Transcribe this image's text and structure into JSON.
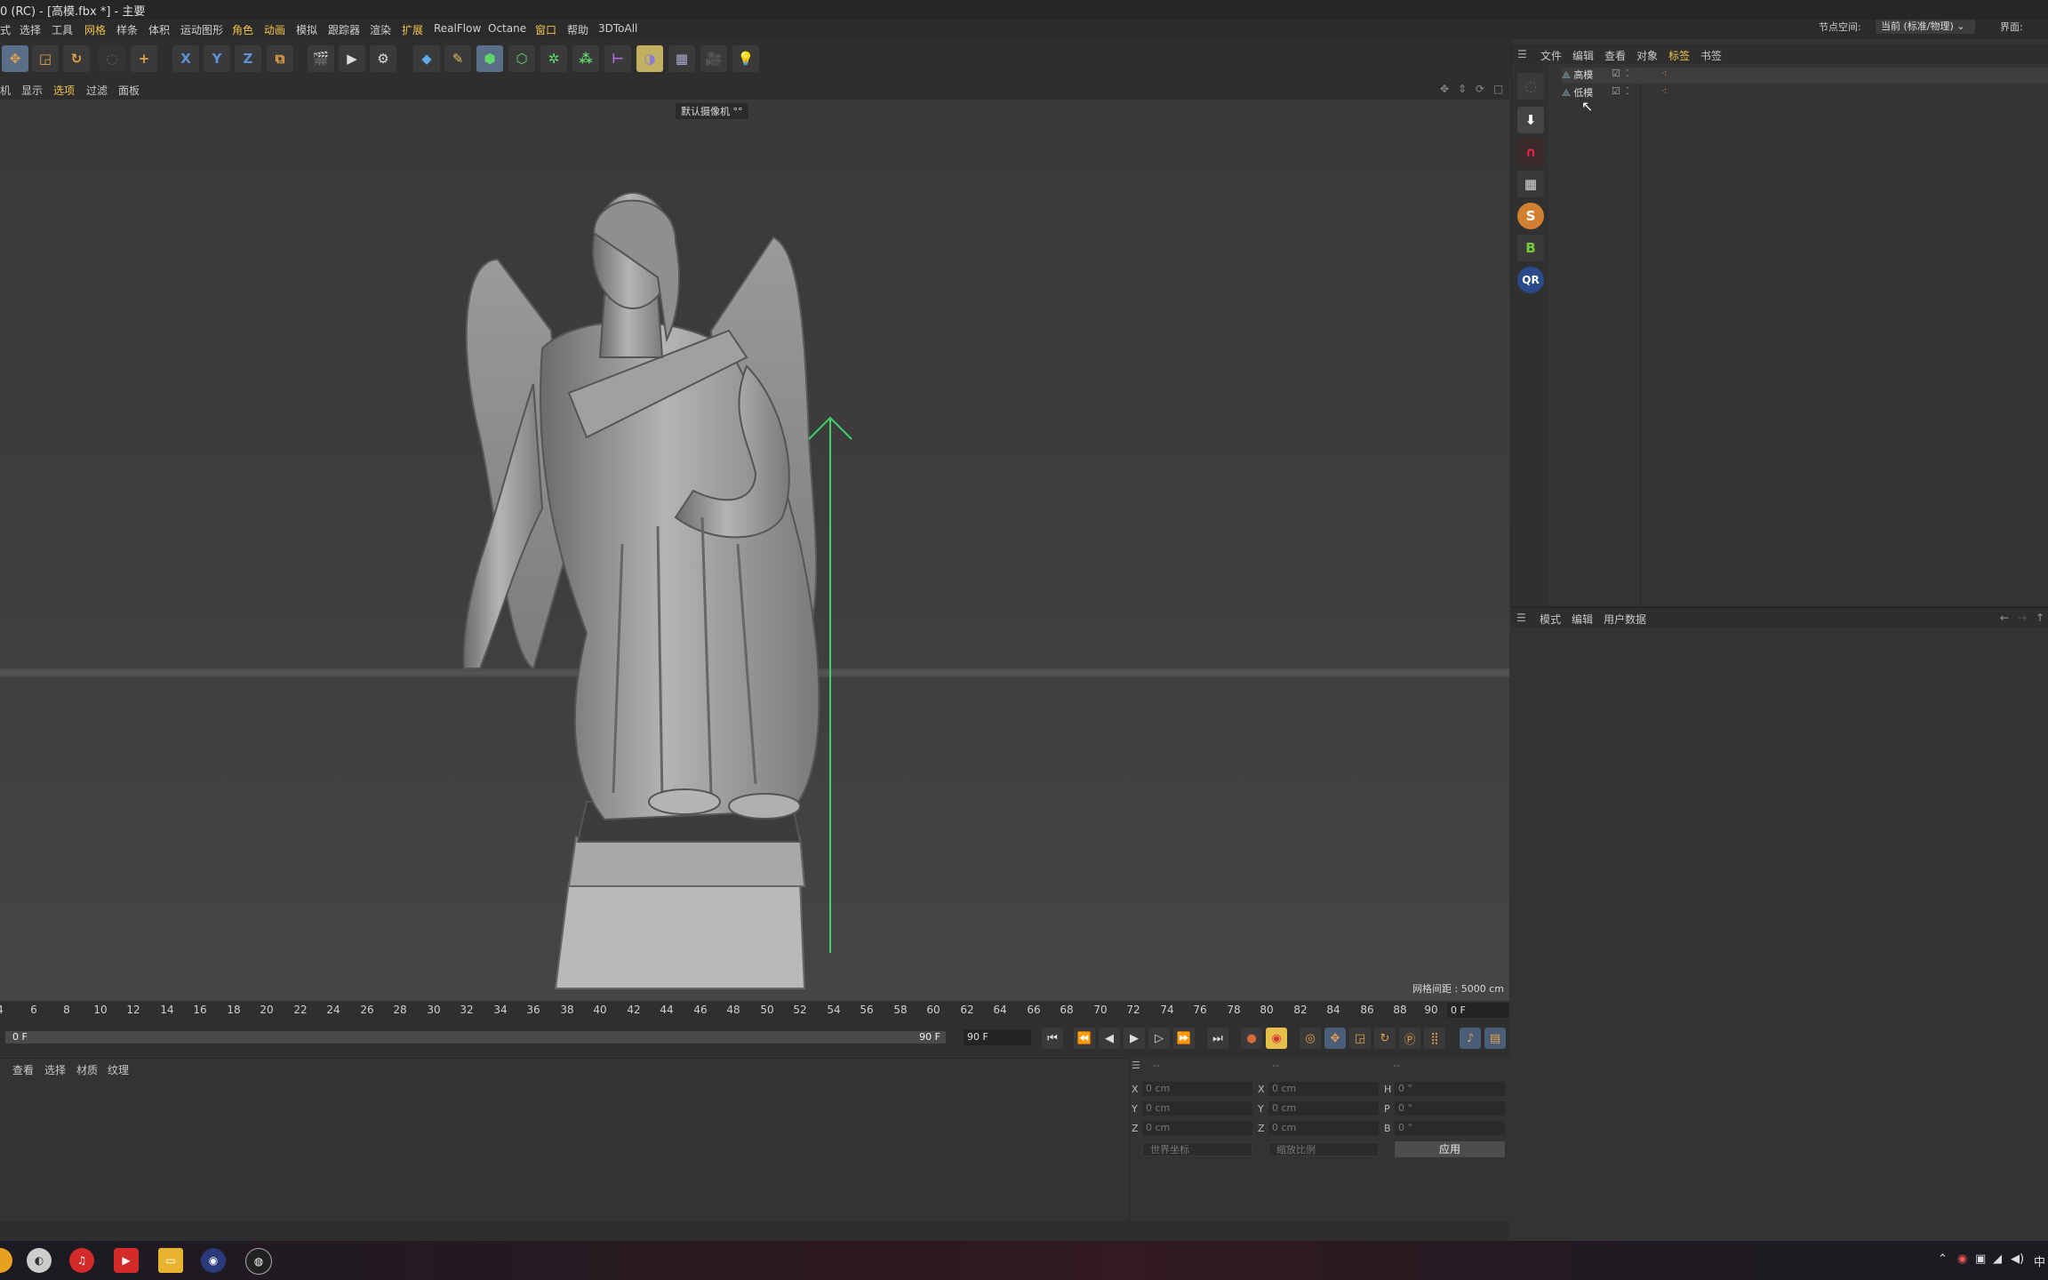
{
  "window": {
    "title": "0 (RC) - [高模.fbx *] - 主要"
  },
  "menubar": {
    "items": [
      "式",
      "选择",
      "工具",
      "网格",
      "样条",
      "体积",
      "运动图形",
      "角色",
      "动画",
      "模拟",
      "跟踪器",
      "渲染",
      "扩展",
      "RealFlow",
      "Octane",
      "窗口",
      "帮助",
      "3DToAll"
    ]
  },
  "toolbar": {
    "axis_x": "X",
    "axis_y": "Y",
    "axis_z": "Z"
  },
  "viewmenu": {
    "items": [
      "机",
      "显示",
      "选项",
      "过滤",
      "面板"
    ]
  },
  "viewport": {
    "camera_label": "默认摄像机 °°",
    "grid_spacing": "网格间距 : 5000 cm"
  },
  "timeline": {
    "ticks": [
      "4",
      "6",
      "8",
      "10",
      "12",
      "14",
      "16",
      "18",
      "20",
      "22",
      "24",
      "26",
      "28",
      "30",
      "32",
      "34",
      "36",
      "38",
      "40",
      "42",
      "44",
      "46",
      "48",
      "50",
      "52",
      "54",
      "56",
      "58",
      "60",
      "62",
      "64",
      "66",
      "68",
      "70",
      "72",
      "74",
      "76",
      "78",
      "80",
      "82",
      "84",
      "86",
      "88",
      "90"
    ],
    "current_frame": "0 F"
  },
  "transport": {
    "range_start": "0 F",
    "range_end": "90 F",
    "end_frame": "90 F"
  },
  "material_panel": {
    "tabs": [
      "查看",
      "选择",
      "材质",
      "纹理"
    ]
  },
  "coordinates": {
    "header": [
      "--",
      "--",
      "--"
    ],
    "rows": [
      {
        "pos_label": "X",
        "pos_value": "0 cm",
        "size_label": "X",
        "size_value": "0 cm",
        "rot_label": "H",
        "rot_value": "0 °"
      },
      {
        "pos_label": "Y",
        "pos_value": "0 cm",
        "size_label": "Y",
        "size_value": "0 cm",
        "rot_label": "P",
        "rot_value": "0 °"
      },
      {
        "pos_label": "Z",
        "pos_value": "0 cm",
        "size_label": "Z",
        "size_value": "0 cm",
        "rot_label": "B",
        "rot_value": "0 °"
      }
    ],
    "coord_system": "世界坐标",
    "scale_mode": "缩放比例",
    "apply_label": "应用"
  },
  "header_right": {
    "node_space_label": "节点空间:",
    "node_space_value": "当前 (标准/物理)",
    "interface_label": "界面:"
  },
  "object_manager": {
    "menu": [
      "文件",
      "编辑",
      "查看",
      "对象",
      "标签",
      "书签"
    ],
    "objects": [
      "高模",
      "低模"
    ]
  },
  "attribute_manager": {
    "menu": [
      "模式",
      "编辑",
      "用户数据"
    ]
  },
  "colors": {
    "accent_menu": "#f2c24a",
    "axis_arrow": "#3fcf6b",
    "background": "#333333"
  }
}
